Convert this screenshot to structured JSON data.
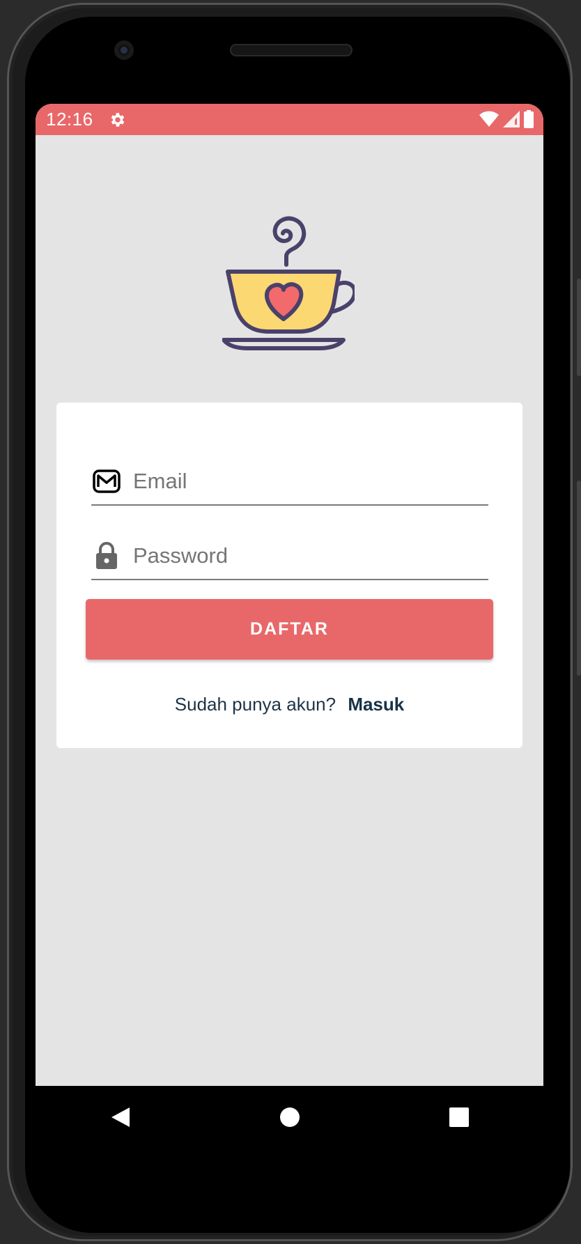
{
  "status_bar": {
    "time": "12:16",
    "icons": [
      "gear-icon",
      "wifi-icon",
      "signal-icon",
      "battery-icon"
    ],
    "color": "#e8686a"
  },
  "logo": {
    "icon": "coffee-cup-heart-icon"
  },
  "form": {
    "email": {
      "placeholder": "Email",
      "icon": "mail-icon"
    },
    "password": {
      "placeholder": "Password",
      "icon": "lock-icon"
    },
    "submit_label": "DAFTAR",
    "login_prompt": "Sudah punya akun?",
    "login_link": "Masuk"
  },
  "nav": {
    "icons": [
      "back-icon",
      "home-icon",
      "recents-icon"
    ]
  },
  "colors": {
    "accent": "#e8686a",
    "background": "#e4e4e4",
    "card": "#ffffff"
  }
}
